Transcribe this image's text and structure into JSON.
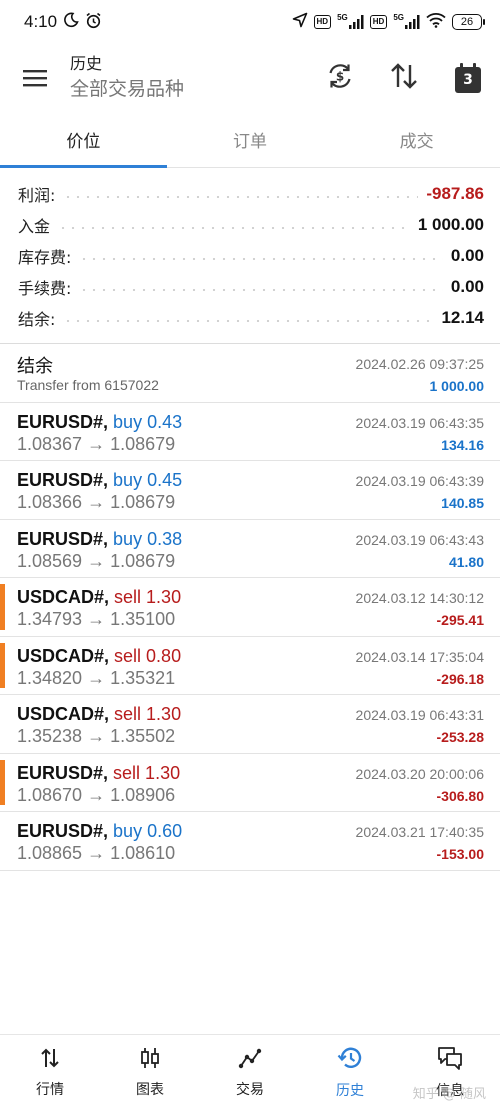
{
  "status_bar": {
    "time": "4:10",
    "badge1": "HD",
    "sig1": "5G",
    "badge2": "HD",
    "sig2": "5G",
    "battery": "26"
  },
  "app_bar": {
    "title": "历史",
    "subtitle": "全部交易品种",
    "calendar_day": "3"
  },
  "tabs": [
    {
      "label": "价位",
      "active": true
    },
    {
      "label": "订单",
      "active": false
    },
    {
      "label": "成交",
      "active": false
    }
  ],
  "summary": [
    {
      "label": "利润:",
      "value": "-987.86",
      "negative": true
    },
    {
      "label": "入金",
      "value": "1 000.00",
      "negative": false
    },
    {
      "label": "库存费:",
      "value": "0.00",
      "negative": false
    },
    {
      "label": "手续费:",
      "value": "0.00",
      "negative": false
    },
    {
      "label": "结余:",
      "value": "12.14",
      "negative": false
    }
  ],
  "balance_entry": {
    "title": "结余",
    "subtitle": "Transfer from 6157022",
    "time": "2024.02.26 09:37:25",
    "amount": "1 000.00"
  },
  "deals": [
    {
      "symbol": "EURUSD#,",
      "side": "buy 0.43",
      "prices": "1.08367 → 1.08679",
      "time": "2024.03.19 06:43:35",
      "profit": "134.16",
      "marker": false
    },
    {
      "symbol": "EURUSD#,",
      "side": "buy 0.45",
      "prices": "1.08366 → 1.08679",
      "time": "2024.03.19 06:43:39",
      "profit": "140.85",
      "marker": false
    },
    {
      "symbol": "EURUSD#,",
      "side": "buy 0.38",
      "prices": "1.08569 → 1.08679",
      "time": "2024.03.19 06:43:43",
      "profit": "41.80",
      "marker": false
    },
    {
      "symbol": "USDCAD#,",
      "side": "sell 1.30",
      "prices": "1.34793 → 1.35100",
      "time": "2024.03.12 14:30:12",
      "profit": "-295.41",
      "marker": true
    },
    {
      "symbol": "USDCAD#,",
      "side": "sell 0.80",
      "prices": "1.34820 → 1.35321",
      "time": "2024.03.14 17:35:04",
      "profit": "-296.18",
      "marker": true
    },
    {
      "symbol": "USDCAD#,",
      "side": "sell 1.30",
      "prices": "1.35238 → 1.35502",
      "time": "2024.03.19 06:43:31",
      "profit": "-253.28",
      "marker": false
    },
    {
      "symbol": "EURUSD#,",
      "side": "sell 1.30",
      "prices": "1.08670 → 1.08906",
      "time": "2024.03.20 20:00:06",
      "profit": "-306.80",
      "marker": true
    },
    {
      "symbol": "EURUSD#,",
      "side": "buy 0.60",
      "prices": "1.08865 → 1.08610",
      "time": "2024.03.21 17:40:35",
      "profit": "-153.00",
      "marker": false
    }
  ],
  "bottom_nav": [
    {
      "label": "行情",
      "icon": "quotes-icon",
      "active": false
    },
    {
      "label": "图表",
      "icon": "chart-icon",
      "active": false
    },
    {
      "label": "交易",
      "icon": "trade-icon",
      "active": false
    },
    {
      "label": "历史",
      "icon": "history-icon",
      "active": true
    },
    {
      "label": "信息",
      "icon": "messages-icon",
      "active": false
    }
  ],
  "watermark": "知乎 @  随风",
  "colors": {
    "accent": "#2f80d6",
    "buy": "#1a73c9",
    "sell": "#b71c1c",
    "marker": "#f07f22"
  }
}
